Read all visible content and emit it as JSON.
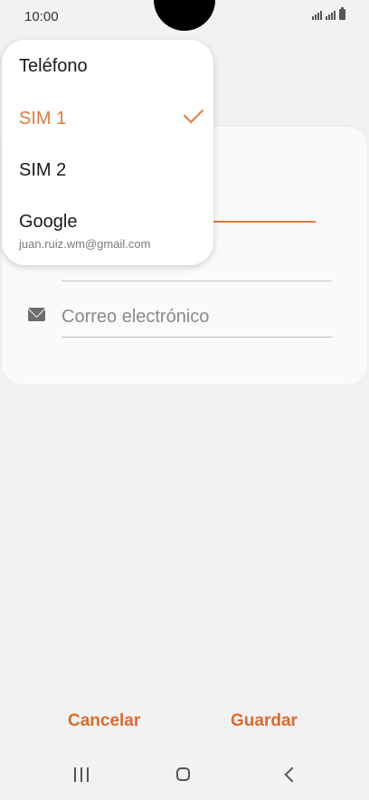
{
  "status_bar": {
    "time": "10:00"
  },
  "menu": {
    "items": [
      {
        "label": "Teléfono"
      },
      {
        "label": "SIM 1",
        "selected": true
      },
      {
        "label": "SIM 2"
      },
      {
        "label": "Google",
        "sublabel": "juan.ruiz.wm@gmail.com"
      }
    ]
  },
  "form": {
    "email_placeholder": "Correo electrónico"
  },
  "actions": {
    "cancel": "Cancelar",
    "save": "Guardar"
  },
  "colors": {
    "accent": "#e07a3f",
    "button_text": "#d96b2f",
    "background": "#f2f2f2"
  },
  "icons": [
    "signal-icon",
    "battery-icon",
    "check-icon",
    "email-icon",
    "recent-apps-icon",
    "home-icon",
    "back-icon"
  ]
}
